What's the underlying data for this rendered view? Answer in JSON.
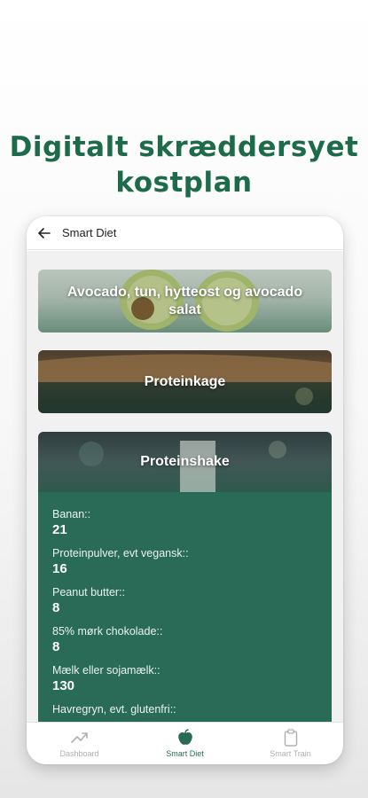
{
  "headline": {
    "line1": "Digitalt skræddersyet",
    "line2": "kostplan"
  },
  "appbar": {
    "title": "Smart Diet",
    "back_icon": "arrow-left-icon"
  },
  "recipes": [
    {
      "title": "Avocado, tun, hytteost og avocado salat"
    },
    {
      "title": "Proteinkage"
    },
    {
      "title": "Proteinshake"
    }
  ],
  "ingredients": [
    {
      "label": "Banan::",
      "value": "21"
    },
    {
      "label": "Proteinpulver, evt vegansk::",
      "value": "16"
    },
    {
      "label": "Peanut butter::",
      "value": "8"
    },
    {
      "label": "85% mørk chokolade::",
      "value": "8"
    },
    {
      "label": "Mælk eller sojamælk::",
      "value": "130"
    },
    {
      "label": "Havregryn, evt. glutenfri::",
      "value": ""
    }
  ],
  "bottom_nav": [
    {
      "label": "Dashboard",
      "icon": "trend-chart-icon",
      "active": false
    },
    {
      "label": "Smart Diet",
      "icon": "apple-icon",
      "active": true
    },
    {
      "label": "Smart Train",
      "icon": "clipboard-icon",
      "active": false
    }
  ],
  "colors": {
    "brand_green": "#1e6b4c",
    "panel_green": "#2a6b57",
    "inactive_gray": "#b0b0b0"
  }
}
